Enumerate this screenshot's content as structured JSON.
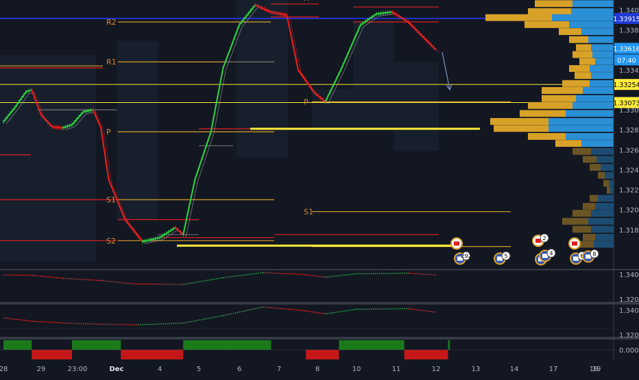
{
  "chart_data": {
    "type": "line",
    "symbol_hint": "GBP/CAD-like FX pair",
    "grid": false,
    "x_axis": {
      "tick_labels": [
        "28",
        "29",
        "23:00",
        "Dec",
        "4",
        "5",
        "6",
        "7",
        "8",
        "10",
        "11",
        "12",
        "13",
        "14",
        "17",
        "18",
        "19"
      ],
      "tick_positions_index": [
        0,
        1,
        2,
        3,
        4,
        5,
        6,
        7,
        8,
        9,
        10,
        11,
        12,
        13,
        14,
        15,
        16
      ]
    },
    "price_axis": {
      "ylim": [
        1.314,
        1.341
      ],
      "tick_labels": [
        "1.34000",
        "1.33800",
        "1.33400",
        "1.33000",
        "1.32800",
        "1.32600",
        "1.32400",
        "1.32200",
        "1.32000",
        "1.31800"
      ],
      "badges": [
        {
          "label": "1.33915",
          "value": 1.33915,
          "bg": "#1f3ad6",
          "fg": "#ffffff"
        },
        {
          "label": "1.33616",
          "value": 1.33616,
          "bg": "#2196f3",
          "fg": "#ffffff"
        },
        {
          "label": "07:40",
          "value": 1.335,
          "bg": "#2196f3",
          "fg": "#ffffff"
        },
        {
          "label": "1.33254",
          "value": 1.33254,
          "bg": "#ffeb3b",
          "fg": "#000000"
        },
        {
          "label": "1.33073",
          "value": 1.33073,
          "bg": "#ffeb3b",
          "fg": "#000000"
        }
      ]
    },
    "pivot_labels": [
      {
        "text": "R2",
        "level": 1.3388
      },
      {
        "text": "R1",
        "level": 1.3348
      },
      {
        "text": "P",
        "level": 1.3278
      },
      {
        "text": "S1",
        "level": 1.321
      },
      {
        "text": "S2",
        "level": 1.3169
      },
      {
        "text": "P",
        "level": 1.3308
      },
      {
        "text": "S1",
        "level": 1.3198
      },
      {
        "text": "R",
        "level": 1.3412
      }
    ],
    "horizontal_lines": [
      {
        "y": 1.33254,
        "color": "#ffeb3b"
      },
      {
        "y": 1.33073,
        "color": "#ffeb3b"
      },
      {
        "y": 1.33915,
        "color": "#2233cc"
      }
    ],
    "price_series": [
      {
        "x": 0,
        "y": 1.3288
      },
      {
        "x": 0.3,
        "y": 1.3302
      },
      {
        "x": 0.6,
        "y": 1.3318
      },
      {
        "x": 0.75,
        "y": 1.332
      },
      {
        "x": 1.0,
        "y": 1.3295
      },
      {
        "x": 1.3,
        "y": 1.3283
      },
      {
        "x": 1.6,
        "y": 1.3282
      },
      {
        "x": 1.85,
        "y": 1.3285
      },
      {
        "x": 2.15,
        "y": 1.3298
      },
      {
        "x": 2.4,
        "y": 1.33
      },
      {
        "x": 2.6,
        "y": 1.3282
      },
      {
        "x": 2.8,
        "y": 1.323
      },
      {
        "x": 3.2,
        "y": 1.319
      },
      {
        "x": 3.6,
        "y": 1.3168
      },
      {
        "x": 4.0,
        "y": 1.3172
      },
      {
        "x": 4.4,
        "y": 1.3182
      },
      {
        "x": 4.6,
        "y": 1.3175
      },
      {
        "x": 4.9,
        "y": 1.323
      },
      {
        "x": 5.3,
        "y": 1.3278
      },
      {
        "x": 5.6,
        "y": 1.3342
      },
      {
        "x": 6.0,
        "y": 1.3385
      },
      {
        "x": 6.4,
        "y": 1.3405
      },
      {
        "x": 6.8,
        "y": 1.3398
      },
      {
        "x": 7.2,
        "y": 1.3395
      },
      {
        "x": 7.5,
        "y": 1.334
      },
      {
        "x": 7.9,
        "y": 1.3318
      },
      {
        "x": 8.2,
        "y": 1.3308
      },
      {
        "x": 8.6,
        "y": 1.334
      },
      {
        "x": 9.1,
        "y": 1.3385
      },
      {
        "x": 9.5,
        "y": 1.3396
      },
      {
        "x": 9.9,
        "y": 1.3398
      },
      {
        "x": 10.3,
        "y": 1.3388
      },
      {
        "x": 10.7,
        "y": 1.3372
      },
      {
        "x": 11.0,
        "y": 1.336
      }
    ],
    "volume_profile_note": "horizontal volume-by-price histogram on right edge",
    "event_icons": [
      {
        "flag": "CA",
        "count": ""
      },
      {
        "flag": "US",
        "count": "292"
      },
      {
        "flag": "US",
        "count": "5"
      },
      {
        "flag": "CA",
        "count": "2"
      },
      {
        "flag": "US",
        "count": "3"
      },
      {
        "flag": "US",
        "count": "4"
      },
      {
        "flag": "CA",
        "count": ""
      },
      {
        "flag": "US",
        "count": "6"
      },
      {
        "flag": "US",
        "count": "8"
      }
    ],
    "sub_panels": [
      {
        "name": "oscillator 1",
        "ylim": [
          1.314,
          1.342
        ],
        "tick_labels": [
          "1.3400",
          "1.3200"
        ]
      },
      {
        "name": "oscillator 2",
        "ylim": [
          1.314,
          1.342
        ],
        "tick_labels": [
          "1.3400",
          "1.3200"
        ]
      },
      {
        "name": "trend bar",
        "ylim": [
          -1,
          1
        ],
        "tick_labels": [
          "0.0000"
        ],
        "segments": [
          {
            "from": 0,
            "to": 0.75,
            "state": "bull"
          },
          {
            "from": 0.75,
            "to": 1.85,
            "state": "bear"
          },
          {
            "from": 1.85,
            "to": 3.1,
            "state": "bull"
          },
          {
            "from": 3.1,
            "to": 4.6,
            "state": "bear"
          },
          {
            "from": 4.6,
            "to": 6.8,
            "state": "bull"
          },
          {
            "from": 7.7,
            "to": 8.55,
            "state": "bear"
          },
          {
            "from": 8.55,
            "to": 10.2,
            "state": "bull"
          },
          {
            "from": 10.2,
            "to": 11.3,
            "state": "bear"
          },
          {
            "from": 11.3,
            "to": 11.35,
            "state": "bull"
          }
        ]
      }
    ],
    "colors": {
      "background": "#131722",
      "up": "#2ecc40",
      "down": "#e02020",
      "profile_up": "#2b8fd6",
      "profile_down": "#d8a228",
      "pivot_text": "#d88a34"
    }
  }
}
